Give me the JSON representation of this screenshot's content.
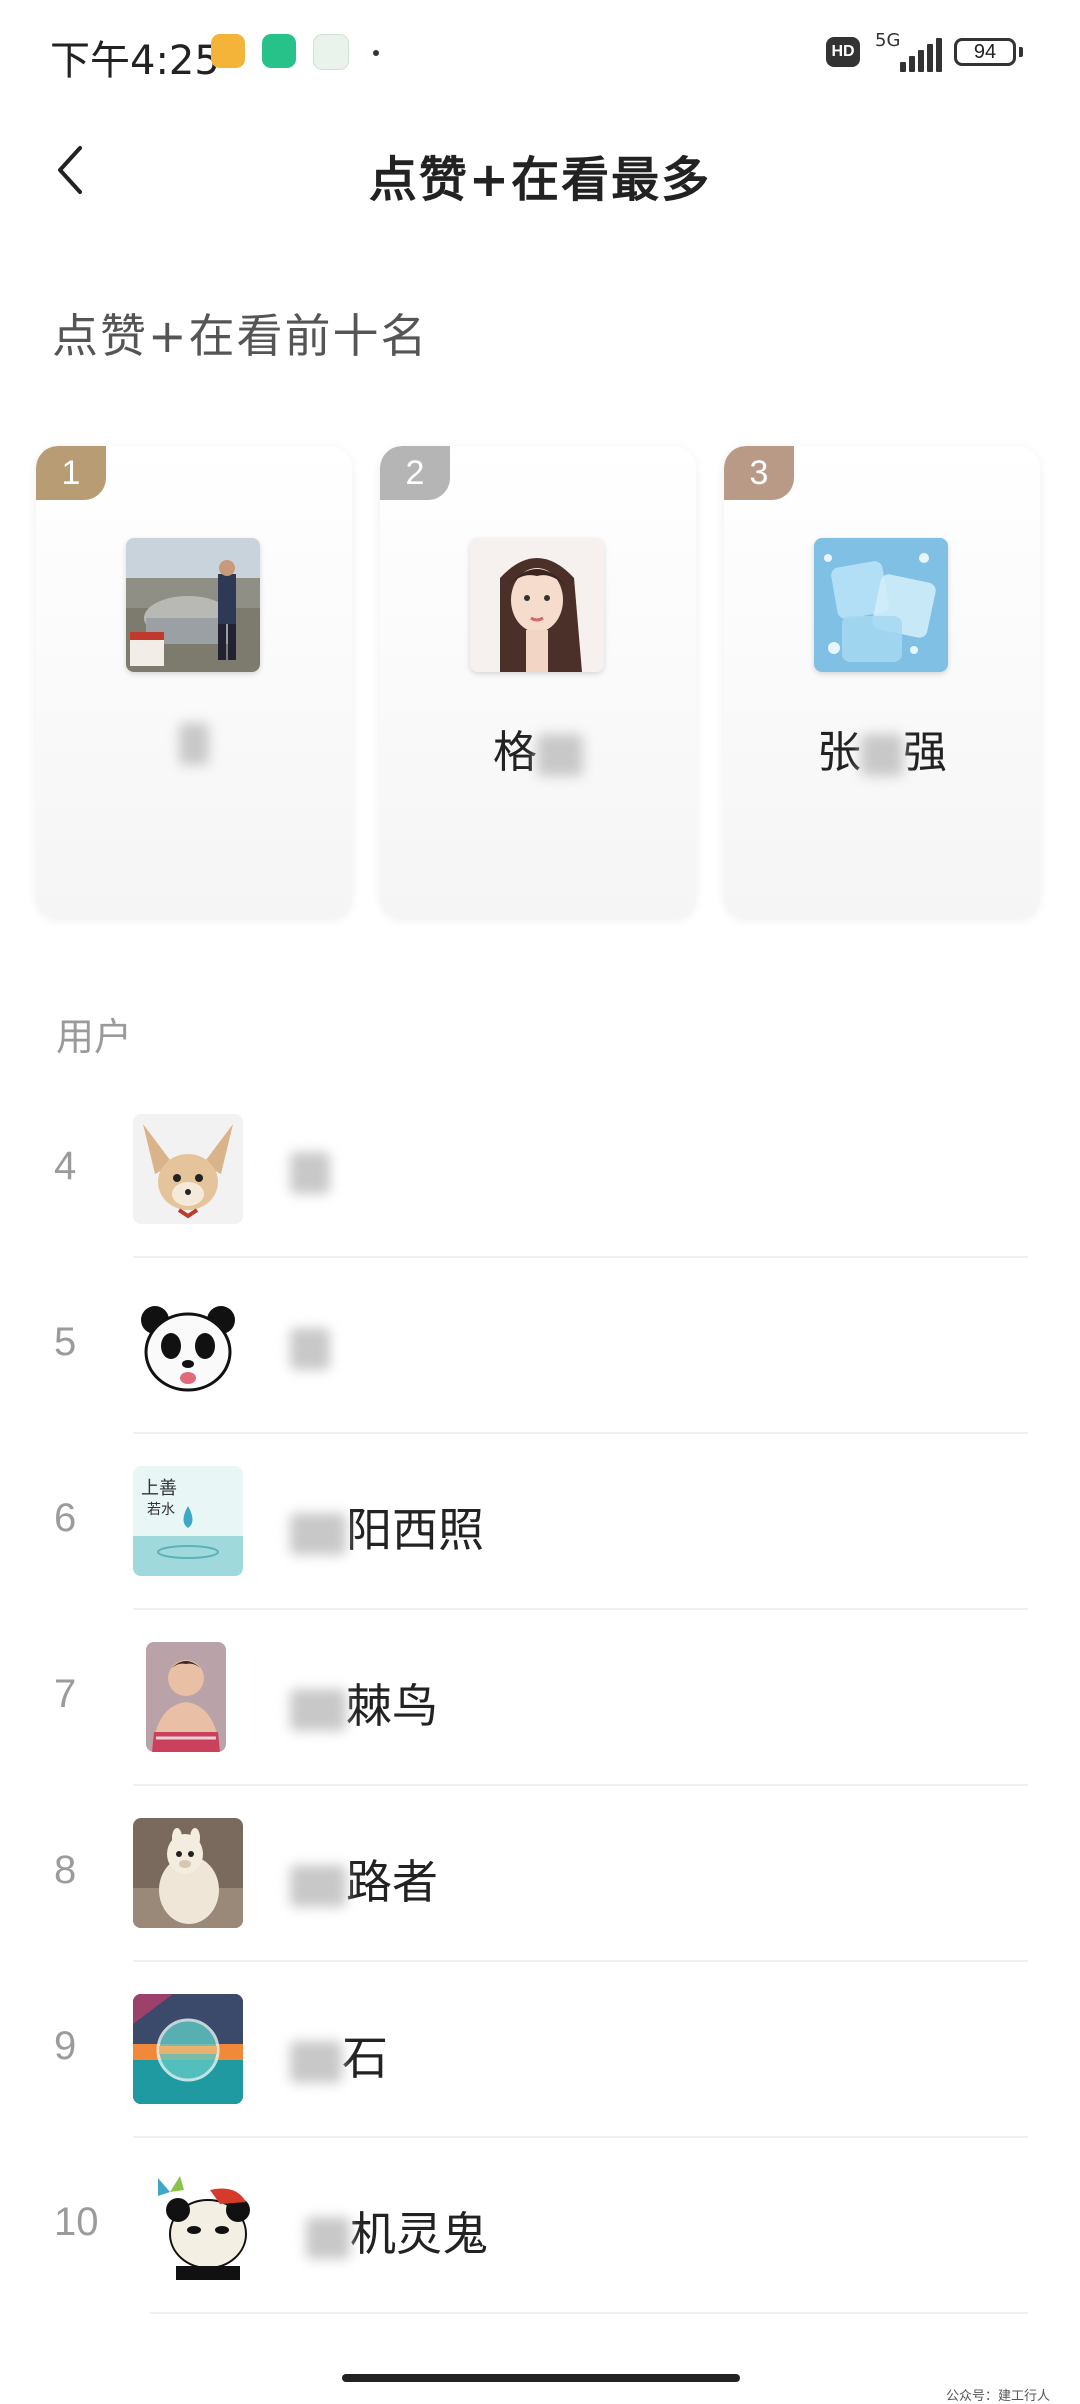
{
  "status_bar": {
    "time": "下午4:25",
    "network": "5G",
    "battery": "94",
    "hd": "HD"
  },
  "header": {
    "title": "点赞+在看最多",
    "back_icon": "chevron-left-icon"
  },
  "top_section": {
    "title": "点赞+在看前十名"
  },
  "podium": [
    {
      "rank": "1",
      "name": "",
      "badge_color": "#b79c74"
    },
    {
      "rank": "2",
      "name_start": "格",
      "name_end": "",
      "badge_color": "#b5b5b5"
    },
    {
      "rank": "3",
      "name_start": "张",
      "name_end": "强",
      "badge_color": "#b99a86"
    }
  ],
  "list": {
    "header": "用户",
    "rows": [
      {
        "rank": "4",
        "name": ""
      },
      {
        "rank": "5",
        "name": ""
      },
      {
        "rank": "6",
        "name": "阳西照"
      },
      {
        "rank": "7",
        "name": "棘鸟"
      },
      {
        "rank": "8",
        "name": "路者"
      },
      {
        "rank": "9",
        "name": "石"
      },
      {
        "rank": "10",
        "name": "机灵鬼"
      }
    ]
  },
  "footer": {
    "watermark": "公众号：建工行人"
  }
}
